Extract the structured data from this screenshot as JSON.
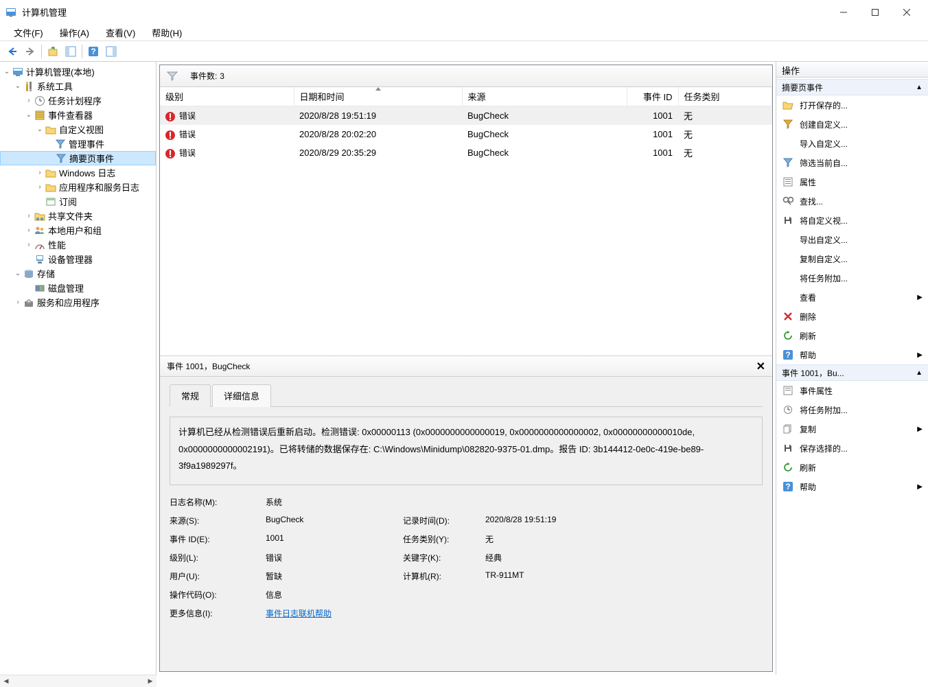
{
  "window_title": "计算机管理",
  "menu": {
    "file": "文件(F)",
    "action": "操作(A)",
    "view": "查看(V)",
    "help": "帮助(H)"
  },
  "tree": {
    "root": "计算机管理(本地)",
    "system_tools": "系统工具",
    "task_scheduler": "任务计划程序",
    "event_viewer": "事件查看器",
    "custom_views": "自定义视图",
    "admin_events": "管理事件",
    "summary_events": "摘要页事件",
    "windows_logs": "Windows 日志",
    "apps_services_logs": "应用程序和服务日志",
    "subscriptions": "订阅",
    "shared_folders": "共享文件夹",
    "local_users_groups": "本地用户和组",
    "performance": "性能",
    "device_manager": "设备管理器",
    "storage": "存储",
    "disk_management": "磁盘管理",
    "services_and_apps": "服务和应用程序"
  },
  "event_list": {
    "header_label": "事件数:",
    "count": "3",
    "columns": {
      "level": "级别",
      "datetime": "日期和时间",
      "source": "来源",
      "event_id": "事件 ID",
      "task_category": "任务类别"
    },
    "rows": [
      {
        "level": "错误",
        "datetime": "2020/8/28 19:51:19",
        "source": "BugCheck",
        "event_id": "1001",
        "task": "无"
      },
      {
        "level": "错误",
        "datetime": "2020/8/28 20:02:20",
        "source": "BugCheck",
        "event_id": "1001",
        "task": "无"
      },
      {
        "level": "错误",
        "datetime": "2020/8/29 20:35:29",
        "source": "BugCheck",
        "event_id": "1001",
        "task": "无"
      }
    ]
  },
  "detail": {
    "title": "事件 1001，BugCheck",
    "tab_general": "常规",
    "tab_details": "详细信息",
    "description": "计算机已经从检测错误后重新启动。检测错误: 0x00000113 (0x0000000000000019, 0x0000000000000002, 0x00000000000010de, 0x0000000000002191)。已将转储的数据保存在: C:\\Windows\\Minidump\\082820-9375-01.dmp。报告 ID: 3b144412-0e0c-419e-be89-3f9a1989297f。",
    "fields": {
      "log_name_lbl": "日志名称(M):",
      "log_name_val": "系统",
      "source_lbl": "来源(S):",
      "source_val": "BugCheck",
      "logged_lbl": "记录时间(D):",
      "logged_val": "2020/8/28 19:51:19",
      "event_id_lbl": "事件 ID(E):",
      "event_id_val": "1001",
      "task_cat_lbl": "任务类别(Y):",
      "task_cat_val": "无",
      "level_lbl": "级别(L):",
      "level_val": "错误",
      "keywords_lbl": "关键字(K):",
      "keywords_val": "经典",
      "user_lbl": "用户(U):",
      "user_val": "暂缺",
      "computer_lbl": "计算机(R):",
      "computer_val": "TR-911MT",
      "opcode_lbl": "操作代码(O):",
      "opcode_val": "信息",
      "more_info_lbl": "更多信息(I):",
      "more_info_link": "事件日志联机帮助"
    }
  },
  "actions": {
    "title": "操作",
    "section1_title": "摘要页事件",
    "open_saved": "打开保存的...",
    "create_custom": "创建自定义...",
    "import_custom": "导入自定义...",
    "filter_current": "筛选当前自...",
    "properties": "属性",
    "find": "查找...",
    "save_custom": "将自定义视...",
    "export_custom": "导出自定义...",
    "copy_custom": "复制自定义...",
    "attach_task": "将任务附加...",
    "view": "查看",
    "delete": "删除",
    "refresh": "刷新",
    "help": "帮助",
    "section2_title": "事件 1001，Bu...",
    "event_props": "事件属性",
    "attach_task2": "将任务附加...",
    "copy": "复制",
    "save_selected": "保存选择的...",
    "refresh2": "刷新",
    "help2": "帮助"
  }
}
